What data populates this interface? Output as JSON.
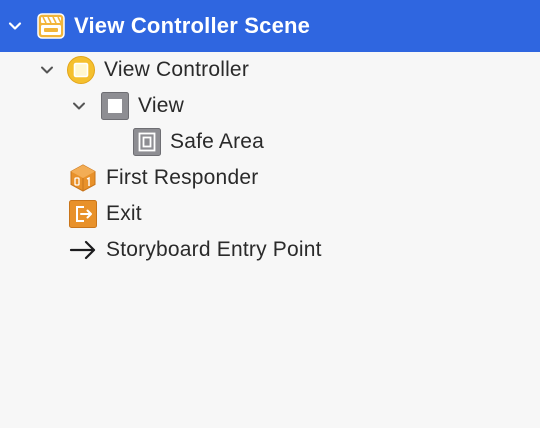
{
  "outline": {
    "scene": {
      "label": "View Controller Scene",
      "icon": "scene-clapperboard-icon",
      "expanded": true,
      "selected": true
    },
    "items": [
      {
        "label": "View Controller",
        "icon": "view-controller-icon",
        "expanded": true,
        "level": 1
      },
      {
        "label": "View",
        "icon": "view-icon",
        "expanded": true,
        "level": 2
      },
      {
        "label": "Safe Area",
        "icon": "safe-area-icon",
        "level": 3
      },
      {
        "label": "First Responder",
        "icon": "first-responder-icon",
        "level": 1
      },
      {
        "label": "Exit",
        "icon": "exit-icon",
        "level": 1
      },
      {
        "label": "Storyboard Entry Point",
        "icon": "arrow-right-icon",
        "level": 1
      }
    ]
  },
  "colors": {
    "selection": "#2f66e0",
    "background": "#f7f7f7",
    "text": "#2a2a2a",
    "scene_icon": "#f2b53a",
    "view_controller_icon": "#f5c02e",
    "first_responder_icon": "#e8912a",
    "exit_icon": "#e8912a"
  }
}
